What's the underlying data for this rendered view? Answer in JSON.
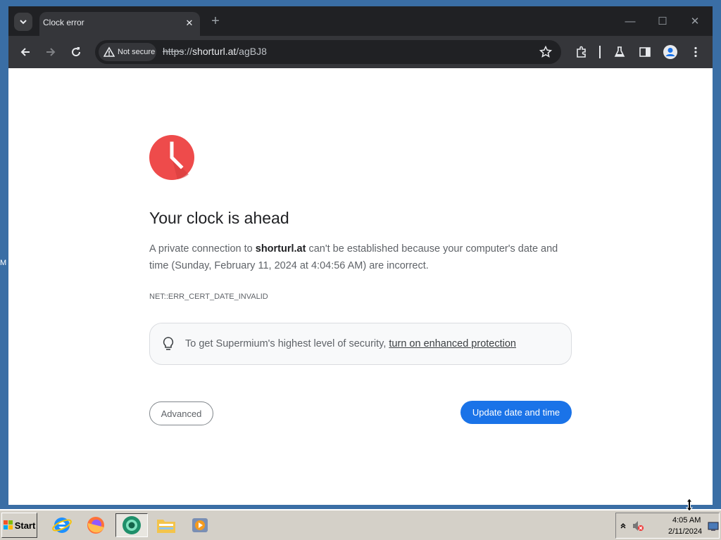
{
  "desktop": {
    "edge_label": "M"
  },
  "browser": {
    "tab": {
      "title": "Clock error",
      "close_glyph": "✕"
    },
    "new_tab_glyph": "+",
    "window_controls": {
      "minimize": "—",
      "maximize": "☐",
      "close": "✕"
    },
    "address_bar": {
      "security_chip": "Not secure",
      "url_scheme": "https",
      "url_sep": "://",
      "url_host": "shorturl.at",
      "url_path": "/agBJ8"
    },
    "icons": [
      "back-icon",
      "forward-icon",
      "reload-icon",
      "warning-icon",
      "star-icon",
      "extensions-icon",
      "labs-icon",
      "side-panel-icon",
      "profile-icon",
      "menu-icon"
    ]
  },
  "page": {
    "heading": "Your clock is ahead",
    "message_pre": "A private connection to ",
    "message_host": "shorturl.at",
    "message_post": " can't be established because your computer's date and time (Sunday, February 11, 2024 at 4:04:56 AM) are incorrect.",
    "error_code": "NET::ERR_CERT_DATE_INVALID",
    "enhanced_text": "To get Supermium's highest level of security, ",
    "enhanced_link": "turn on enhanced protection",
    "advanced_button": "Advanced",
    "update_button": "Update date and time",
    "colors": {
      "clock_icon": "#ee4b4b",
      "primary_button": "#1a73e8"
    }
  },
  "taskbar": {
    "start_label": "Start",
    "apps": [
      "internet-explorer-icon",
      "firefox-icon",
      "supermium-icon",
      "file-explorer-icon",
      "media-player-icon"
    ],
    "clock_time": "4:05 AM",
    "clock_date": "2/11/2024"
  }
}
